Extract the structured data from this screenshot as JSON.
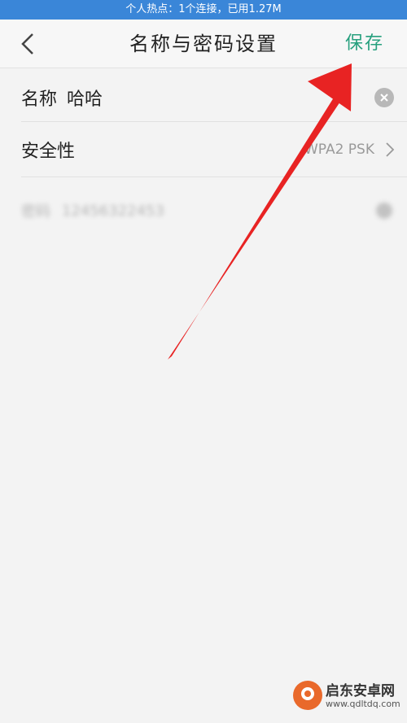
{
  "status_bar": {
    "text": "个人热点：1个连接，已用1.27M"
  },
  "header": {
    "title": "名称与密码设置",
    "save_label": "保存"
  },
  "name_row": {
    "label": "名称",
    "value": "哈哈"
  },
  "security_row": {
    "label": "安全性",
    "value": "WPA2 PSK"
  },
  "password_row": {
    "label": "密码",
    "value": "12456322453"
  },
  "watermark": {
    "name": "启东安卓网",
    "url": "www.qdltdq.com"
  },
  "colors": {
    "status_bar": "#3a86d8",
    "accent": "#27a07e",
    "arrow": "#e82323"
  }
}
